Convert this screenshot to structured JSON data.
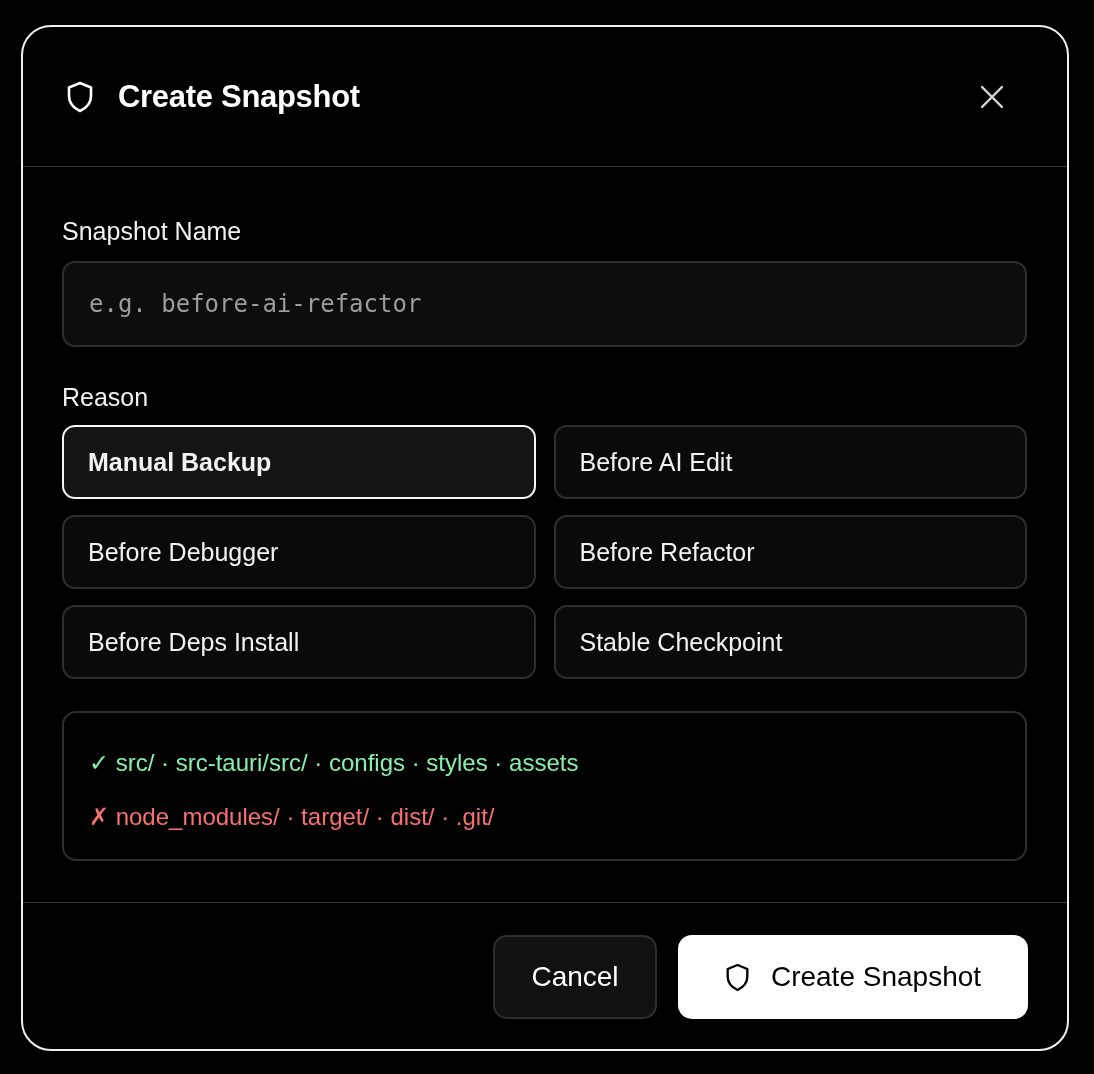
{
  "dialog": {
    "title": "Create Snapshot"
  },
  "name_field": {
    "label": "Snapshot Name",
    "placeholder": "e.g. before-ai-refactor"
  },
  "reason": {
    "label": "Reason",
    "options": [
      {
        "label": "Manual Backup",
        "selected": true
      },
      {
        "label": "Before AI Edit",
        "selected": false
      },
      {
        "label": "Before Debugger",
        "selected": false
      },
      {
        "label": "Before Refactor",
        "selected": false
      },
      {
        "label": "Before Deps Install",
        "selected": false
      },
      {
        "label": "Stable Checkpoint",
        "selected": false
      }
    ]
  },
  "scope": {
    "lines": [
      {
        "kind": "included",
        "text": "✓ src/ · src-tauri/src/ · configs · styles · assets"
      },
      {
        "kind": "excluded",
        "text": "✗ node_modules/ · target/ · dist/ · .git/"
      }
    ]
  },
  "footer": {
    "buttons": [
      {
        "kind": "secondary",
        "label": "Cancel"
      },
      {
        "kind": "primary",
        "label": "Create Snapshot"
      }
    ]
  }
}
